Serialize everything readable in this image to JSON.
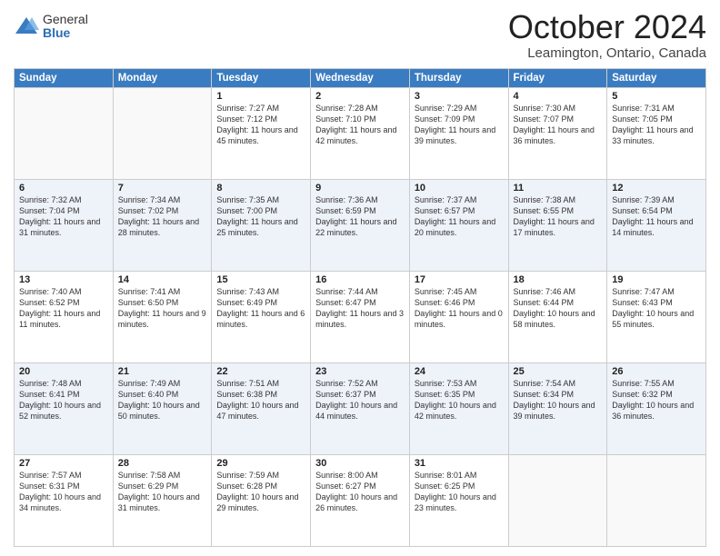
{
  "logo": {
    "general": "General",
    "blue": "Blue"
  },
  "header": {
    "title": "October 2024",
    "location": "Leamington, Ontario, Canada"
  },
  "weekdays": [
    "Sunday",
    "Monday",
    "Tuesday",
    "Wednesday",
    "Thursday",
    "Friday",
    "Saturday"
  ],
  "weeks": [
    [
      {
        "day": "",
        "sunrise": "",
        "sunset": "",
        "daylight": ""
      },
      {
        "day": "",
        "sunrise": "",
        "sunset": "",
        "daylight": ""
      },
      {
        "day": "1",
        "sunrise": "Sunrise: 7:27 AM",
        "sunset": "Sunset: 7:12 PM",
        "daylight": "Daylight: 11 hours and 45 minutes."
      },
      {
        "day": "2",
        "sunrise": "Sunrise: 7:28 AM",
        "sunset": "Sunset: 7:10 PM",
        "daylight": "Daylight: 11 hours and 42 minutes."
      },
      {
        "day": "3",
        "sunrise": "Sunrise: 7:29 AM",
        "sunset": "Sunset: 7:09 PM",
        "daylight": "Daylight: 11 hours and 39 minutes."
      },
      {
        "day": "4",
        "sunrise": "Sunrise: 7:30 AM",
        "sunset": "Sunset: 7:07 PM",
        "daylight": "Daylight: 11 hours and 36 minutes."
      },
      {
        "day": "5",
        "sunrise": "Sunrise: 7:31 AM",
        "sunset": "Sunset: 7:05 PM",
        "daylight": "Daylight: 11 hours and 33 minutes."
      }
    ],
    [
      {
        "day": "6",
        "sunrise": "Sunrise: 7:32 AM",
        "sunset": "Sunset: 7:04 PM",
        "daylight": "Daylight: 11 hours and 31 minutes."
      },
      {
        "day": "7",
        "sunrise": "Sunrise: 7:34 AM",
        "sunset": "Sunset: 7:02 PM",
        "daylight": "Daylight: 11 hours and 28 minutes."
      },
      {
        "day": "8",
        "sunrise": "Sunrise: 7:35 AM",
        "sunset": "Sunset: 7:00 PM",
        "daylight": "Daylight: 11 hours and 25 minutes."
      },
      {
        "day": "9",
        "sunrise": "Sunrise: 7:36 AM",
        "sunset": "Sunset: 6:59 PM",
        "daylight": "Daylight: 11 hours and 22 minutes."
      },
      {
        "day": "10",
        "sunrise": "Sunrise: 7:37 AM",
        "sunset": "Sunset: 6:57 PM",
        "daylight": "Daylight: 11 hours and 20 minutes."
      },
      {
        "day": "11",
        "sunrise": "Sunrise: 7:38 AM",
        "sunset": "Sunset: 6:55 PM",
        "daylight": "Daylight: 11 hours and 17 minutes."
      },
      {
        "day": "12",
        "sunrise": "Sunrise: 7:39 AM",
        "sunset": "Sunset: 6:54 PM",
        "daylight": "Daylight: 11 hours and 14 minutes."
      }
    ],
    [
      {
        "day": "13",
        "sunrise": "Sunrise: 7:40 AM",
        "sunset": "Sunset: 6:52 PM",
        "daylight": "Daylight: 11 hours and 11 minutes."
      },
      {
        "day": "14",
        "sunrise": "Sunrise: 7:41 AM",
        "sunset": "Sunset: 6:50 PM",
        "daylight": "Daylight: 11 hours and 9 minutes."
      },
      {
        "day": "15",
        "sunrise": "Sunrise: 7:43 AM",
        "sunset": "Sunset: 6:49 PM",
        "daylight": "Daylight: 11 hours and 6 minutes."
      },
      {
        "day": "16",
        "sunrise": "Sunrise: 7:44 AM",
        "sunset": "Sunset: 6:47 PM",
        "daylight": "Daylight: 11 hours and 3 minutes."
      },
      {
        "day": "17",
        "sunrise": "Sunrise: 7:45 AM",
        "sunset": "Sunset: 6:46 PM",
        "daylight": "Daylight: 11 hours and 0 minutes."
      },
      {
        "day": "18",
        "sunrise": "Sunrise: 7:46 AM",
        "sunset": "Sunset: 6:44 PM",
        "daylight": "Daylight: 10 hours and 58 minutes."
      },
      {
        "day": "19",
        "sunrise": "Sunrise: 7:47 AM",
        "sunset": "Sunset: 6:43 PM",
        "daylight": "Daylight: 10 hours and 55 minutes."
      }
    ],
    [
      {
        "day": "20",
        "sunrise": "Sunrise: 7:48 AM",
        "sunset": "Sunset: 6:41 PM",
        "daylight": "Daylight: 10 hours and 52 minutes."
      },
      {
        "day": "21",
        "sunrise": "Sunrise: 7:49 AM",
        "sunset": "Sunset: 6:40 PM",
        "daylight": "Daylight: 10 hours and 50 minutes."
      },
      {
        "day": "22",
        "sunrise": "Sunrise: 7:51 AM",
        "sunset": "Sunset: 6:38 PM",
        "daylight": "Daylight: 10 hours and 47 minutes."
      },
      {
        "day": "23",
        "sunrise": "Sunrise: 7:52 AM",
        "sunset": "Sunset: 6:37 PM",
        "daylight": "Daylight: 10 hours and 44 minutes."
      },
      {
        "day": "24",
        "sunrise": "Sunrise: 7:53 AM",
        "sunset": "Sunset: 6:35 PM",
        "daylight": "Daylight: 10 hours and 42 minutes."
      },
      {
        "day": "25",
        "sunrise": "Sunrise: 7:54 AM",
        "sunset": "Sunset: 6:34 PM",
        "daylight": "Daylight: 10 hours and 39 minutes."
      },
      {
        "day": "26",
        "sunrise": "Sunrise: 7:55 AM",
        "sunset": "Sunset: 6:32 PM",
        "daylight": "Daylight: 10 hours and 36 minutes."
      }
    ],
    [
      {
        "day": "27",
        "sunrise": "Sunrise: 7:57 AM",
        "sunset": "Sunset: 6:31 PM",
        "daylight": "Daylight: 10 hours and 34 minutes."
      },
      {
        "day": "28",
        "sunrise": "Sunrise: 7:58 AM",
        "sunset": "Sunset: 6:29 PM",
        "daylight": "Daylight: 10 hours and 31 minutes."
      },
      {
        "day": "29",
        "sunrise": "Sunrise: 7:59 AM",
        "sunset": "Sunset: 6:28 PM",
        "daylight": "Daylight: 10 hours and 29 minutes."
      },
      {
        "day": "30",
        "sunrise": "Sunrise: 8:00 AM",
        "sunset": "Sunset: 6:27 PM",
        "daylight": "Daylight: 10 hours and 26 minutes."
      },
      {
        "day": "31",
        "sunrise": "Sunrise: 8:01 AM",
        "sunset": "Sunset: 6:25 PM",
        "daylight": "Daylight: 10 hours and 23 minutes."
      },
      {
        "day": "",
        "sunrise": "",
        "sunset": "",
        "daylight": ""
      },
      {
        "day": "",
        "sunrise": "",
        "sunset": "",
        "daylight": ""
      }
    ]
  ]
}
